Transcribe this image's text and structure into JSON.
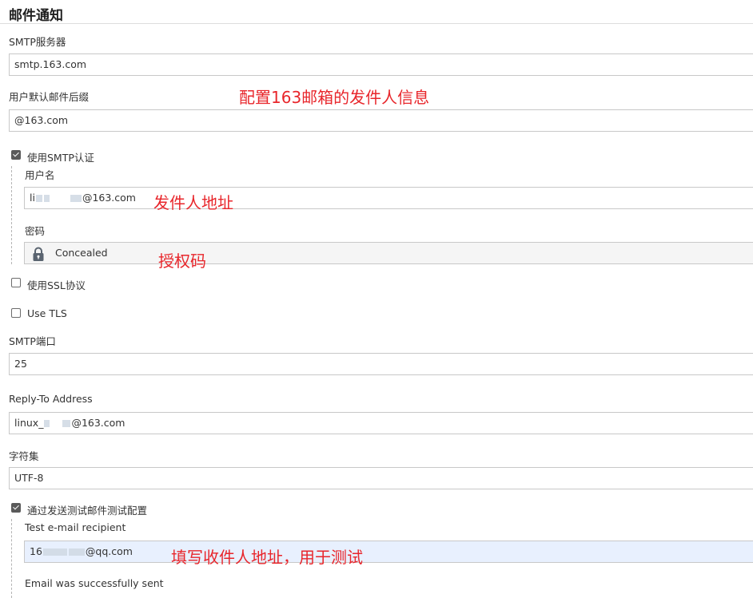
{
  "section": {
    "title": "邮件通知"
  },
  "smtp_server": {
    "label": "SMTP服务器",
    "value": "smtp.163.com"
  },
  "default_suffix": {
    "label": "用户默认邮件后缀",
    "value": "@163.com"
  },
  "smtp_auth": {
    "label": "使用SMTP认证",
    "checked": true,
    "username": {
      "label": "用户名",
      "value_prefix": "li",
      "value_suffix": "@163.com"
    },
    "password": {
      "label": "密码",
      "value": "Concealed",
      "icon": "lock-icon"
    }
  },
  "use_ssl": {
    "label": "使用SSL协议",
    "checked": false
  },
  "use_tls": {
    "label": "Use TLS",
    "checked": false
  },
  "smtp_port": {
    "label": "SMTP端口",
    "value": "25"
  },
  "reply_to": {
    "label": "Reply-To Address",
    "value_prefix": "linux_",
    "value_suffix": "@163.com"
  },
  "charset": {
    "label": "字符集",
    "value": "UTF-8"
  },
  "test_config": {
    "label": "通过发送测试邮件测试配置",
    "checked": true,
    "recipient": {
      "label": "Test e-mail recipient",
      "value_prefix": "16",
      "value_suffix": "@qq.com"
    },
    "status": "Email was successfully sent"
  },
  "annotations": {
    "sender_info": "配置163邮箱的发件人信息",
    "sender_address": "发件人地址",
    "auth_code": "授权码",
    "recipient_hint": "填写收件人地址，用于测试"
  },
  "colors": {
    "annotation": "#e8262b",
    "recipient_field_bg": "#e8f0fe",
    "concealed_field_bg": "#f5f5f5"
  }
}
